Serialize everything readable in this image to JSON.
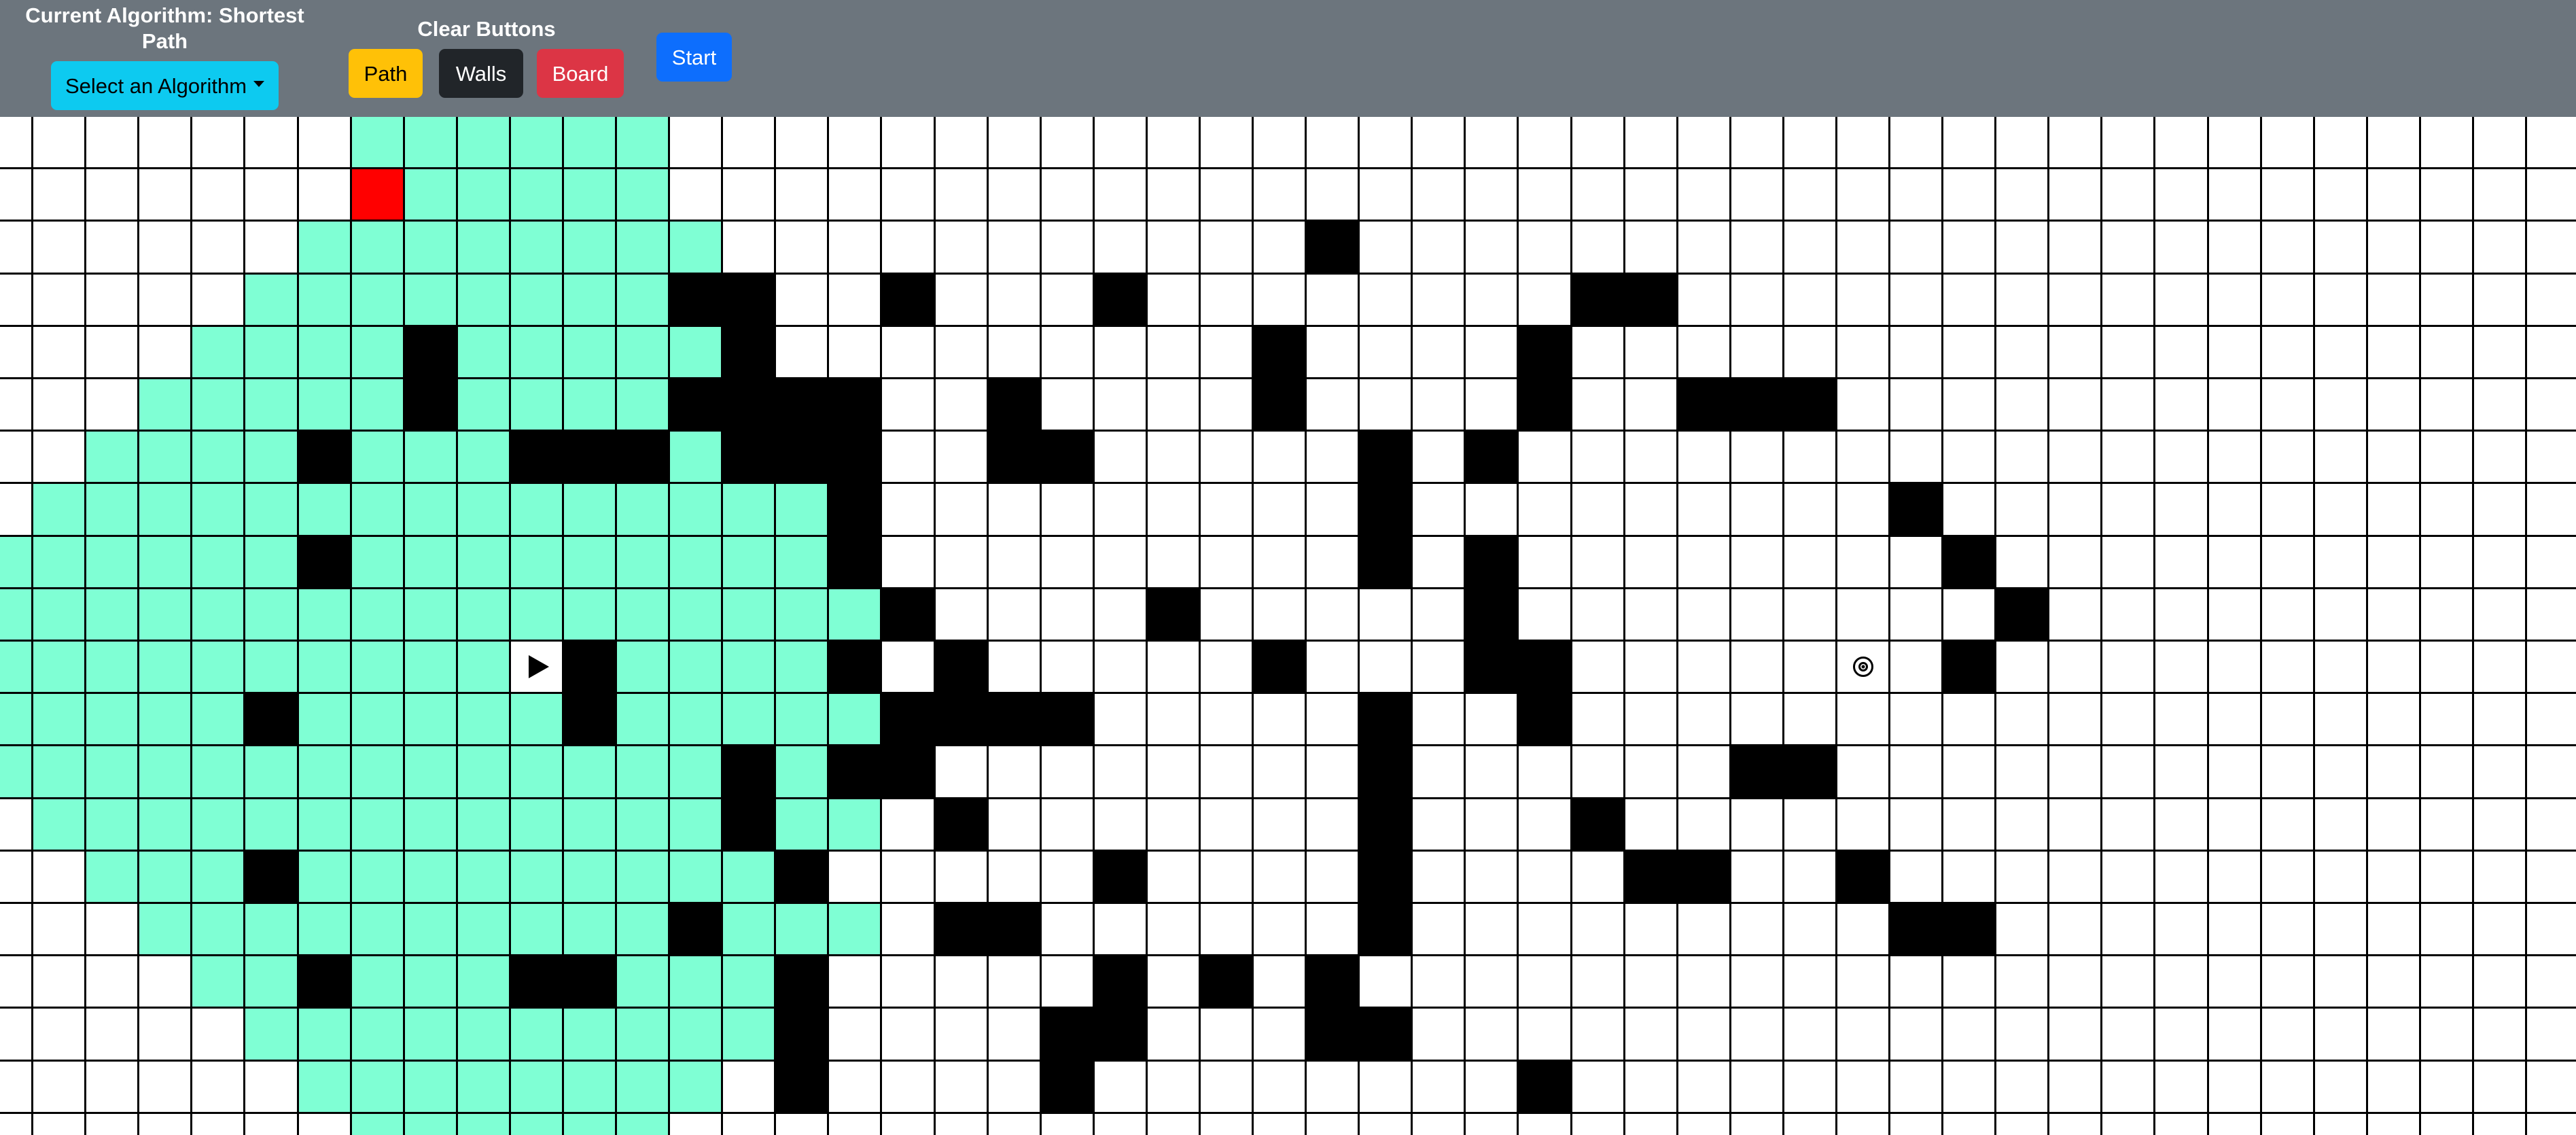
{
  "header": {
    "algorithm_title": "Current Algorithm: Shortest Path",
    "select_label": "Select an Algorithm",
    "clear_title": "Clear Buttons",
    "clear_buttons": {
      "path": "Path",
      "walls": "Walls",
      "board": "Board"
    },
    "start_label": "Start"
  },
  "icons": {
    "start_node": "play-icon",
    "target_node": "target-icon",
    "dropdown": "caret-down-icon"
  },
  "colors": {
    "navbar": "#6c757d",
    "visited": "#7fffd4",
    "wall": "#000000",
    "current": "#ff0000",
    "select_button": "#0dcaf0",
    "path_button": "#ffc107",
    "walls_button": "#212529",
    "board_button": "#dc3545",
    "start_button": "#0d6efd"
  },
  "grid": {
    "rows": 20,
    "cols": 49,
    "start": [
      10,
      10
    ],
    "target": [
      10,
      35
    ],
    "current": [
      1,
      7
    ],
    "walls": [
      [
        2,
        25
      ],
      [
        3,
        13
      ],
      [
        3,
        14
      ],
      [
        3,
        17
      ],
      [
        3,
        21
      ],
      [
        3,
        30
      ],
      [
        3,
        31
      ],
      [
        4,
        8
      ],
      [
        4,
        14
      ],
      [
        4,
        24
      ],
      [
        4,
        29
      ],
      [
        5,
        8
      ],
      [
        5,
        13
      ],
      [
        5,
        14
      ],
      [
        5,
        15
      ],
      [
        5,
        16
      ],
      [
        5,
        19
      ],
      [
        5,
        24
      ],
      [
        5,
        29
      ],
      [
        5,
        32
      ],
      [
        5,
        33
      ],
      [
        5,
        34
      ],
      [
        6,
        6
      ],
      [
        6,
        10
      ],
      [
        6,
        11
      ],
      [
        6,
        12
      ],
      [
        6,
        14
      ],
      [
        6,
        15
      ],
      [
        6,
        16
      ],
      [
        6,
        19
      ],
      [
        6,
        20
      ],
      [
        6,
        26
      ],
      [
        6,
        28
      ],
      [
        7,
        16
      ],
      [
        7,
        26
      ],
      [
        7,
        36
      ],
      [
        8,
        6
      ],
      [
        8,
        16
      ],
      [
        8,
        26
      ],
      [
        8,
        28
      ],
      [
        8,
        37
      ],
      [
        9,
        17
      ],
      [
        9,
        22
      ],
      [
        9,
        28
      ],
      [
        9,
        38
      ],
      [
        10,
        11
      ],
      [
        10,
        16
      ],
      [
        10,
        18
      ],
      [
        10,
        24
      ],
      [
        10,
        28
      ],
      [
        10,
        29
      ],
      [
        10,
        37
      ],
      [
        11,
        5
      ],
      [
        11,
        11
      ],
      [
        11,
        17
      ],
      [
        11,
        18
      ],
      [
        11,
        19
      ],
      [
        11,
        20
      ],
      [
        11,
        26
      ],
      [
        11,
        29
      ],
      [
        12,
        14
      ],
      [
        12,
        16
      ],
      [
        12,
        17
      ],
      [
        12,
        26
      ],
      [
        12,
        33
      ],
      [
        12,
        34
      ],
      [
        13,
        14
      ],
      [
        13,
        18
      ],
      [
        13,
        26
      ],
      [
        13,
        30
      ],
      [
        14,
        5
      ],
      [
        14,
        15
      ],
      [
        14,
        21
      ],
      [
        14,
        26
      ],
      [
        14,
        31
      ],
      [
        14,
        32
      ],
      [
        14,
        35
      ],
      [
        15,
        13
      ],
      [
        15,
        18
      ],
      [
        15,
        19
      ],
      [
        15,
        26
      ],
      [
        15,
        36
      ],
      [
        15,
        37
      ],
      [
        16,
        6
      ],
      [
        16,
        10
      ],
      [
        16,
        11
      ],
      [
        16,
        15
      ],
      [
        16,
        21
      ],
      [
        16,
        23
      ],
      [
        16,
        25
      ],
      [
        17,
        15
      ],
      [
        17,
        20
      ],
      [
        17,
        21
      ],
      [
        17,
        25
      ],
      [
        17,
        26
      ],
      [
        18,
        15
      ],
      [
        18,
        20
      ],
      [
        18,
        29
      ]
    ],
    "visited_rows": [
      [
        [
          7,
          12
        ]
      ],
      [
        [
          8,
          12
        ]
      ],
      [
        [
          6,
          13
        ]
      ],
      [
        [
          5,
          13
        ]
      ],
      [
        [
          4,
          14
        ]
      ],
      [
        [
          3,
          14
        ]
      ],
      [
        [
          2,
          13
        ]
      ],
      [
        [
          1,
          16
        ]
      ],
      [
        [
          0,
          16
        ]
      ],
      [
        [
          0,
          17
        ]
      ],
      [
        [
          0,
          16
        ]
      ],
      [
        [
          0,
          17
        ]
      ],
      [
        [
          0,
          16
        ]
      ],
      [
        [
          1,
          16
        ]
      ],
      [
        [
          2,
          15
        ]
      ],
      [
        [
          3,
          16
        ]
      ],
      [
        [
          4,
          15
        ]
      ],
      [
        [
          5,
          14
        ]
      ],
      [
        [
          6,
          13
        ]
      ],
      [
        [
          7,
          12
        ]
      ]
    ]
  }
}
